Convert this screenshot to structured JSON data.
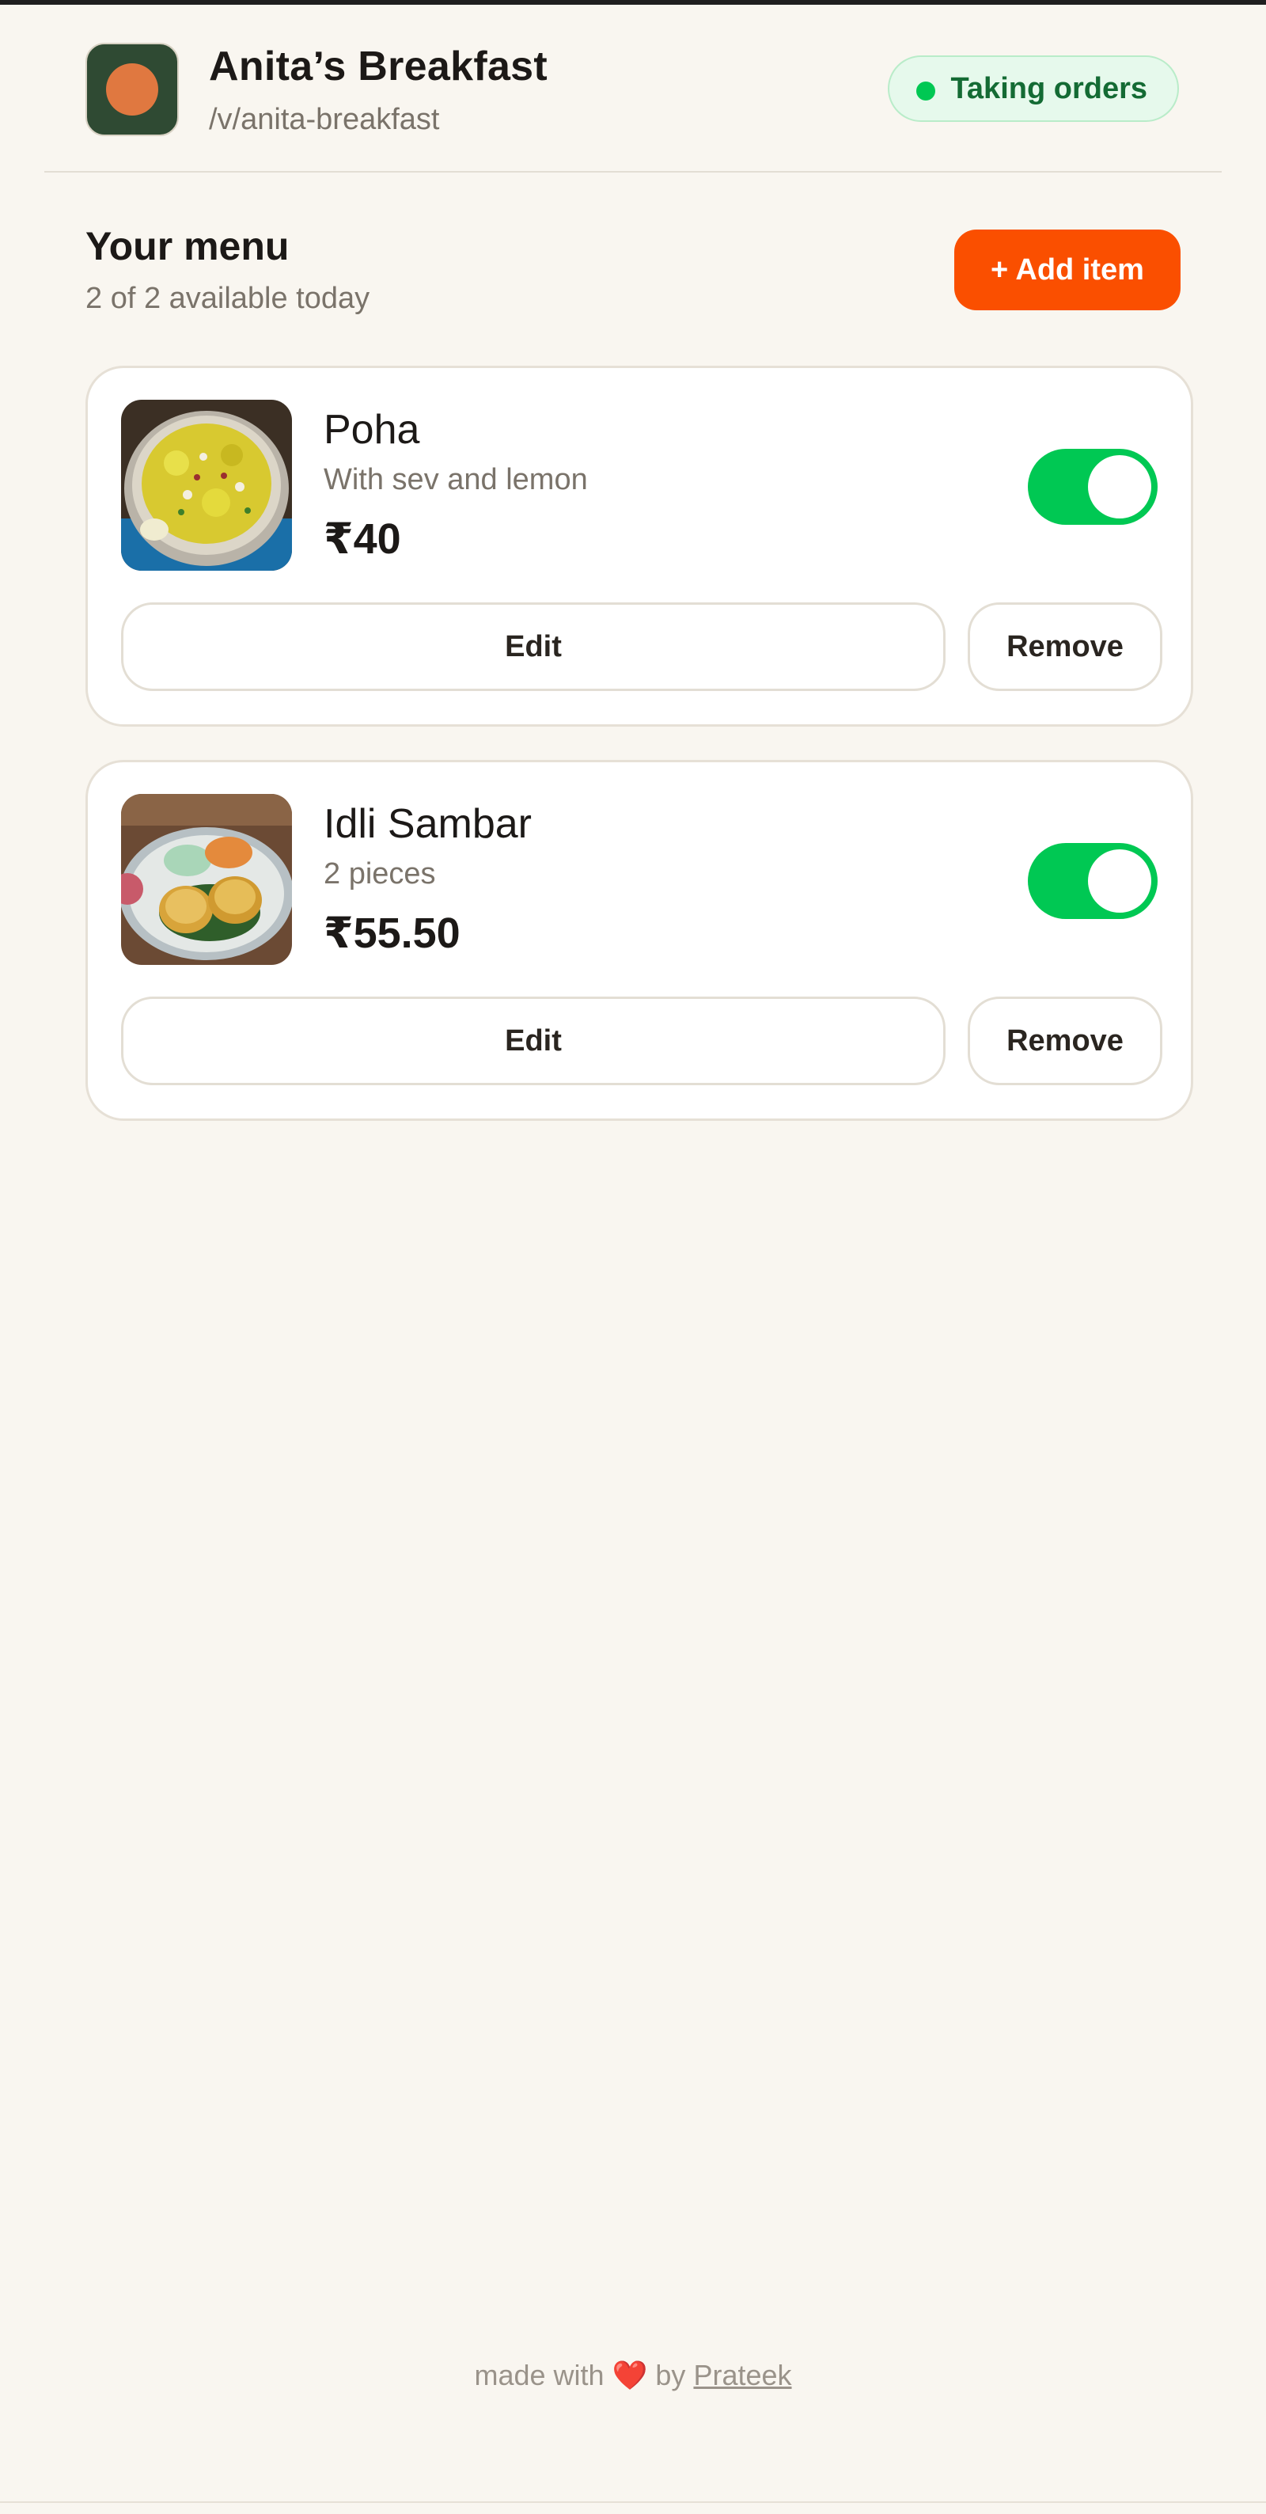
{
  "header": {
    "store_name": "Anita’s Breakfast",
    "store_slug": "/v/anita-breakfast",
    "status_label": "Taking orders"
  },
  "menu": {
    "title": "Your menu",
    "subtitle": "2 of 2 available today",
    "add_button_label": "+ Add item"
  },
  "items": [
    {
      "name": "Poha",
      "description": "With sev and lemon",
      "price": "₹40",
      "available": true,
      "edit_label": "Edit",
      "remove_label": "Remove"
    },
    {
      "name": "Idli Sambar",
      "description": "2 pieces",
      "price": "₹55.50",
      "available": true,
      "edit_label": "Edit",
      "remove_label": "Remove"
    }
  ],
  "footer": {
    "made_with": "made with",
    "heart": "❤️",
    "by": "by",
    "author": "Prateek"
  },
  "colors": {
    "accent": "#fa4f00",
    "toggle_on": "#00c853",
    "status_green": "#146b34",
    "background": "#f9f6f0"
  }
}
